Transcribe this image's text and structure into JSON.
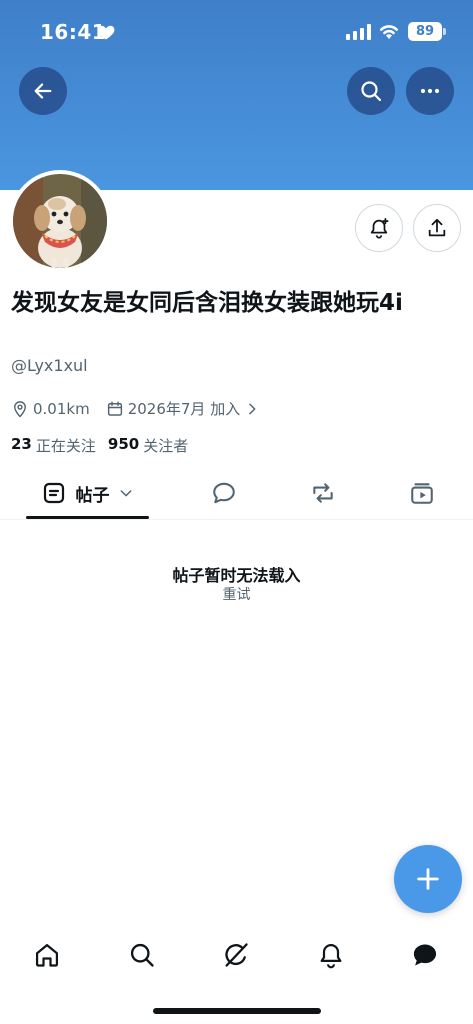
{
  "status_bar": {
    "time": "16:41",
    "battery": "89"
  },
  "profile": {
    "name": "发现女友是女同后含泪换女装跟她玩4i",
    "handle": "@Lyx1xul",
    "location": "0.01km",
    "joined": "2026年7月 加入",
    "following_count": "23",
    "following_label": "正在关注",
    "followers_count": "950",
    "followers_label": "关注者"
  },
  "tabs": {
    "posts_label": "帖子"
  },
  "empty_state": {
    "title": "帖子暂时无法载入",
    "retry": "重试"
  },
  "colors": {
    "banner": "#4b96e0",
    "accent": "#4a99e9",
    "text": "#0f1419",
    "secondary": "#536471"
  },
  "icons": [
    "back-arrow-icon",
    "search-icon",
    "more-icon",
    "notify-add-icon",
    "share-icon",
    "location-icon",
    "calendar-icon",
    "chevron-right-icon",
    "posts-icon",
    "chevron-down-icon",
    "reply-icon",
    "repost-icon",
    "media-icon",
    "plus-icon",
    "home-icon",
    "explore-icon",
    "grok-icon",
    "bell-icon",
    "messages-icon"
  ]
}
